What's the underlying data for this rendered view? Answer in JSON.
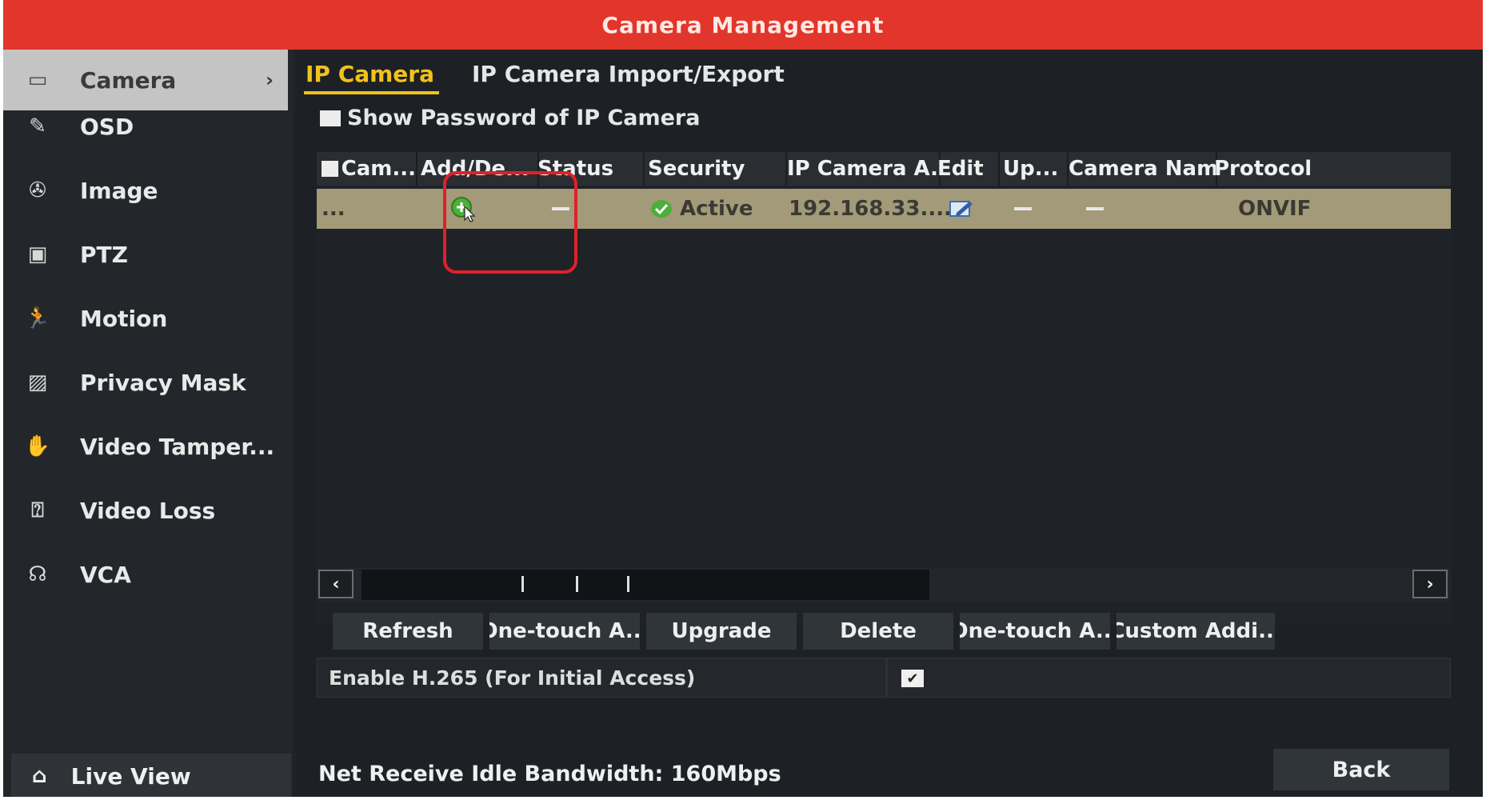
{
  "title": "Camera Management",
  "sidebar": {
    "items": [
      {
        "label": "Camera",
        "icon": "camera-icon",
        "glyph": "▭"
      },
      {
        "label": "OSD",
        "icon": "osd-icon",
        "glyph": "✎"
      },
      {
        "label": "Image",
        "icon": "image-icon",
        "glyph": "✇"
      },
      {
        "label": "PTZ",
        "icon": "ptz-icon",
        "glyph": "▣"
      },
      {
        "label": "Motion",
        "icon": "motion-icon",
        "glyph": "🏃"
      },
      {
        "label": "Privacy Mask",
        "icon": "privacy-mask-icon",
        "glyph": "▨"
      },
      {
        "label": "Video Tamper...",
        "icon": "video-tamper-icon",
        "glyph": "✋"
      },
      {
        "label": "Video Loss",
        "icon": "video-loss-icon",
        "glyph": "⍰"
      },
      {
        "label": "VCA",
        "icon": "vca-icon",
        "glyph": "☊"
      }
    ],
    "active_chevron": "›",
    "live_view": "Live View",
    "home_glyph": "⌂"
  },
  "tabs": {
    "ip_camera": "IP Camera",
    "import_export": "IP Camera Import/Export"
  },
  "show_password": "Show Password of IP Camera",
  "table": {
    "headers": [
      "Cam...",
      "Add/De...",
      "Status",
      "Security",
      "IP Camera A...",
      "Edit",
      "Up...",
      "Camera Name",
      "Protocol"
    ],
    "row": {
      "cam": "...",
      "add_delete_icon": "add-icon",
      "security": "Active",
      "ip": "192.168.33....",
      "protocol": "ONVIF"
    }
  },
  "scroll": {
    "left": "‹",
    "right": "›"
  },
  "buttons": [
    "Refresh",
    "One-touch A...",
    "Upgrade",
    "Delete",
    "One-touch A...",
    "Custom Addi..."
  ],
  "h265_label": "Enable H.265 (For Initial Access)",
  "h265_checked": "✔",
  "bandwidth": "Net Receive Idle Bandwidth: 160Mbps",
  "back": "Back",
  "colors": {
    "title_bar": "#e2352b",
    "active_tab": "#f2c21b",
    "selected_row": "#a39a79",
    "highlight": "#e0202a"
  }
}
